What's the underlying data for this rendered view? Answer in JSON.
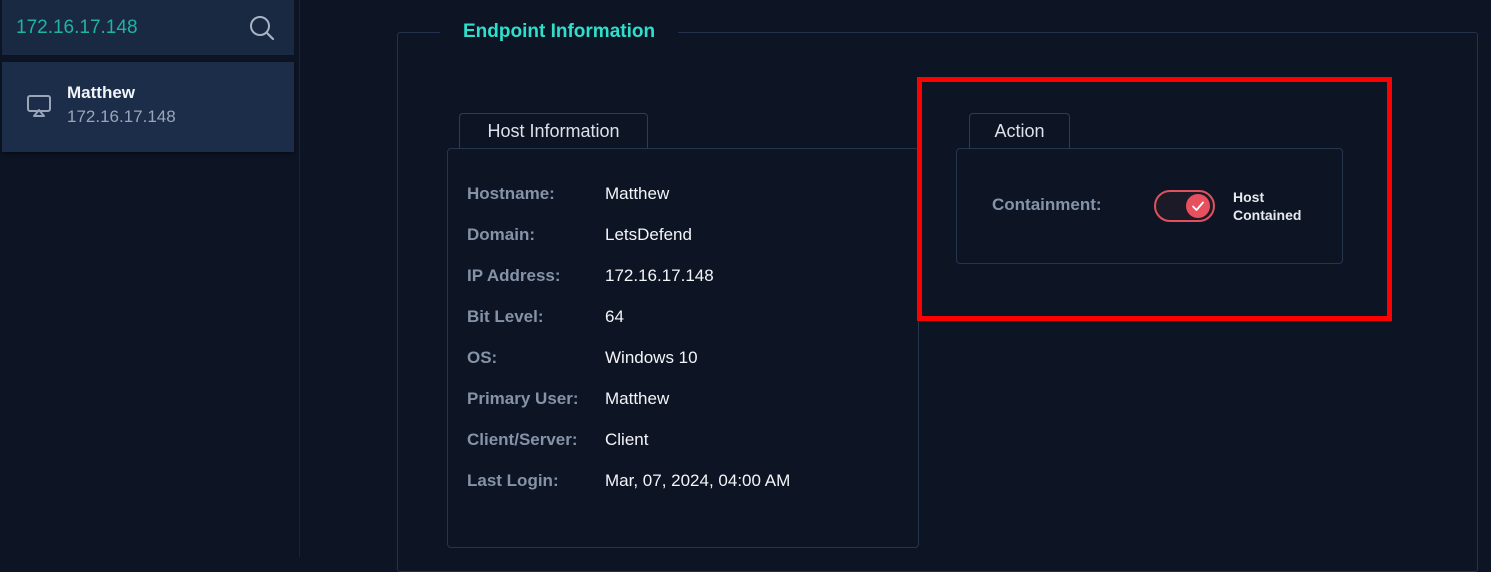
{
  "search": {
    "value": "172.16.17.148",
    "icon": "search-icon"
  },
  "host_list": [
    {
      "name": "Matthew",
      "ip": "172.16.17.148",
      "icon": "monitor-icon"
    }
  ],
  "endpoint": {
    "title": "Endpoint Information",
    "host_info": {
      "tab_label": "Host Information",
      "fields": [
        {
          "label": "Hostname:",
          "value": "Matthew"
        },
        {
          "label": "Domain:",
          "value": "LetsDefend"
        },
        {
          "label": "IP Address:",
          "value": "172.16.17.148"
        },
        {
          "label": "Bit Level:",
          "value": "64"
        },
        {
          "label": "OS:",
          "value": "Windows 10"
        },
        {
          "label": "Primary User:",
          "value": "Matthew"
        },
        {
          "label": "Client/Server:",
          "value": "Client"
        },
        {
          "label": "Last Login:",
          "value": "Mar, 07, 2024, 04:00 AM"
        }
      ]
    },
    "action": {
      "tab_label": "Action",
      "containment_label": "Containment:",
      "toggle_state": true,
      "toggle_status_line1": "Host",
      "toggle_status_line2": "Contained"
    }
  },
  "colors": {
    "accent": "#2ee0cc",
    "search_text": "#1fb3a4",
    "toggle_on": "#e8505e",
    "highlight": "#ff0000",
    "background": "#0d1423"
  }
}
